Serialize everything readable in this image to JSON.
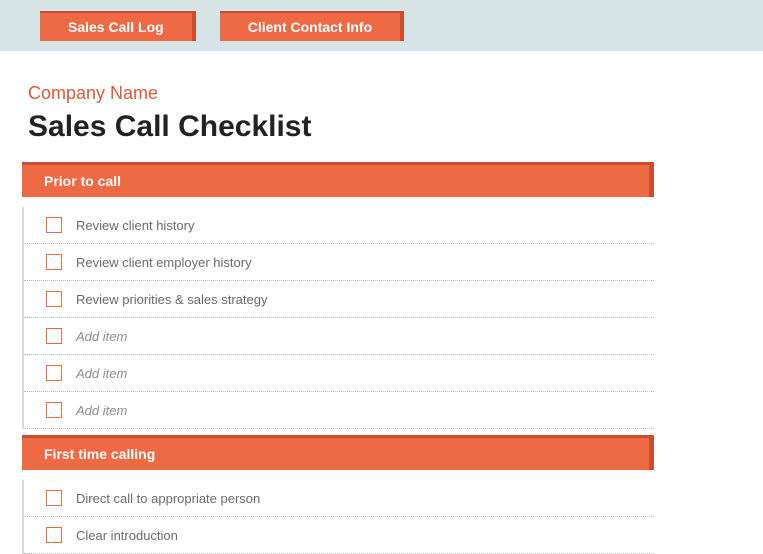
{
  "tabs": [
    {
      "label": "Sales Call Log"
    },
    {
      "label": "Client Contact Info"
    }
  ],
  "company_name": "Company Name",
  "page_title": "Sales Call Checklist",
  "sections": [
    {
      "title": "Prior to call",
      "items": [
        {
          "label": "Review client history",
          "placeholder": false
        },
        {
          "label": "Review client employer history",
          "placeholder": false
        },
        {
          "label": "Review priorities & sales strategy",
          "placeholder": false
        },
        {
          "label": "Add item",
          "placeholder": true
        },
        {
          "label": "Add item",
          "placeholder": true
        },
        {
          "label": "Add item",
          "placeholder": true
        }
      ]
    },
    {
      "title": "First time calling",
      "items": [
        {
          "label": "Direct call to appropriate person",
          "placeholder": false
        },
        {
          "label": "Clear introduction",
          "placeholder": false
        }
      ]
    }
  ]
}
